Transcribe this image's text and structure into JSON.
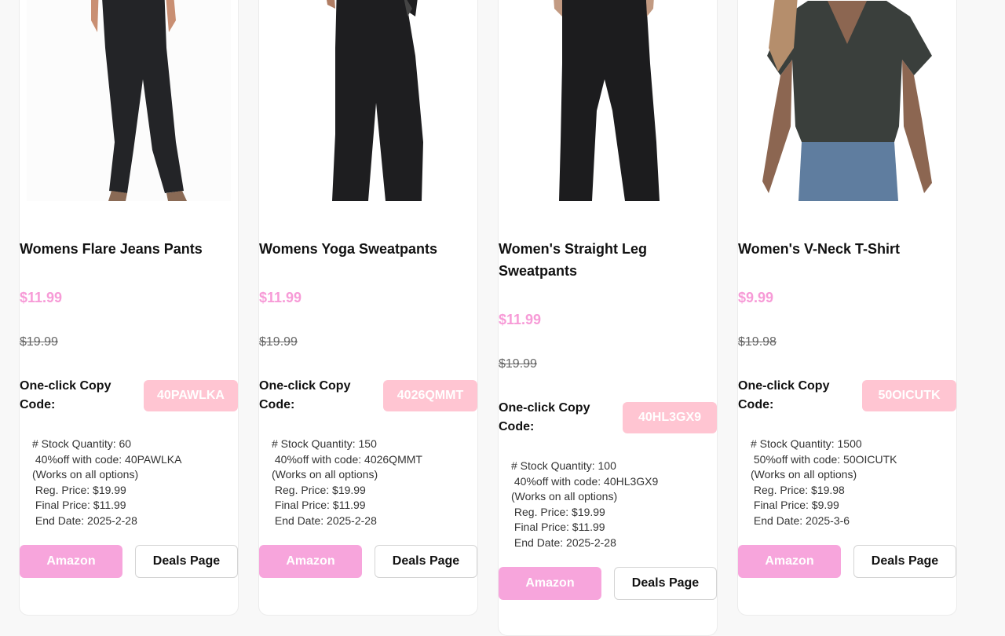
{
  "products": [
    {
      "title": "Womens Flare Jeans Pants",
      "price": "$11.99",
      "old_price": "$19.99",
      "copy_label": "One-click Copy Code:",
      "code": "40PAWLKA",
      "desc": [
        "# Stock Quantity: 60",
        " 40%off with code: 40PAWLKA",
        "(Works on all options)",
        " Reg. Price: $19.99",
        " Final Price: $11.99",
        " End Date: 2025-2-28"
      ],
      "amazon_label": "Amazon",
      "deals_label": "Deals Page"
    },
    {
      "title": "Womens Yoga Sweatpants",
      "price": "$11.99",
      "old_price": "$19.99",
      "copy_label": "One-click Copy Code:",
      "code": "4026QMMT",
      "desc": [
        "# Stock Quantity: 150",
        " 40%off with code: 4026QMMT",
        "(Works on all options)",
        " Reg. Price: $19.99",
        " Final Price: $11.99",
        " End Date: 2025-2-28"
      ],
      "amazon_label": "Amazon",
      "deals_label": "Deals Page"
    },
    {
      "title": "Women's Straight Leg Sweatpants",
      "price": "$11.99",
      "old_price": "$19.99",
      "copy_label": "One-click Copy Code:",
      "code": "40HL3GX9",
      "desc": [
        "# Stock Quantity: 100",
        " 40%off with code: 40HL3GX9",
        "(Works on all options)",
        " Reg. Price: $19.99",
        " Final Price: $11.99",
        " End Date: 2025-2-28"
      ],
      "amazon_label": "Amazon",
      "deals_label": "Deals Page"
    },
    {
      "title": "Women's V-Neck T-Shirt",
      "price": "$9.99",
      "old_price": "$19.98",
      "copy_label": "One-click Copy Code:",
      "code": "50OICUTK",
      "desc": [
        "# Stock Quantity: 1500",
        " 50%off with code: 50OICUTK",
        "(Works on all options)",
        " Reg. Price: $19.98",
        " Final Price: $9.99",
        " End Date: 2025-3-6"
      ],
      "amazon_label": "Amazon",
      "deals_label": "Deals Page"
    }
  ],
  "colors": {
    "price": "#f79bd7",
    "code_button": "#ffc5d2",
    "amazon_button": "#f7a5dc"
  }
}
